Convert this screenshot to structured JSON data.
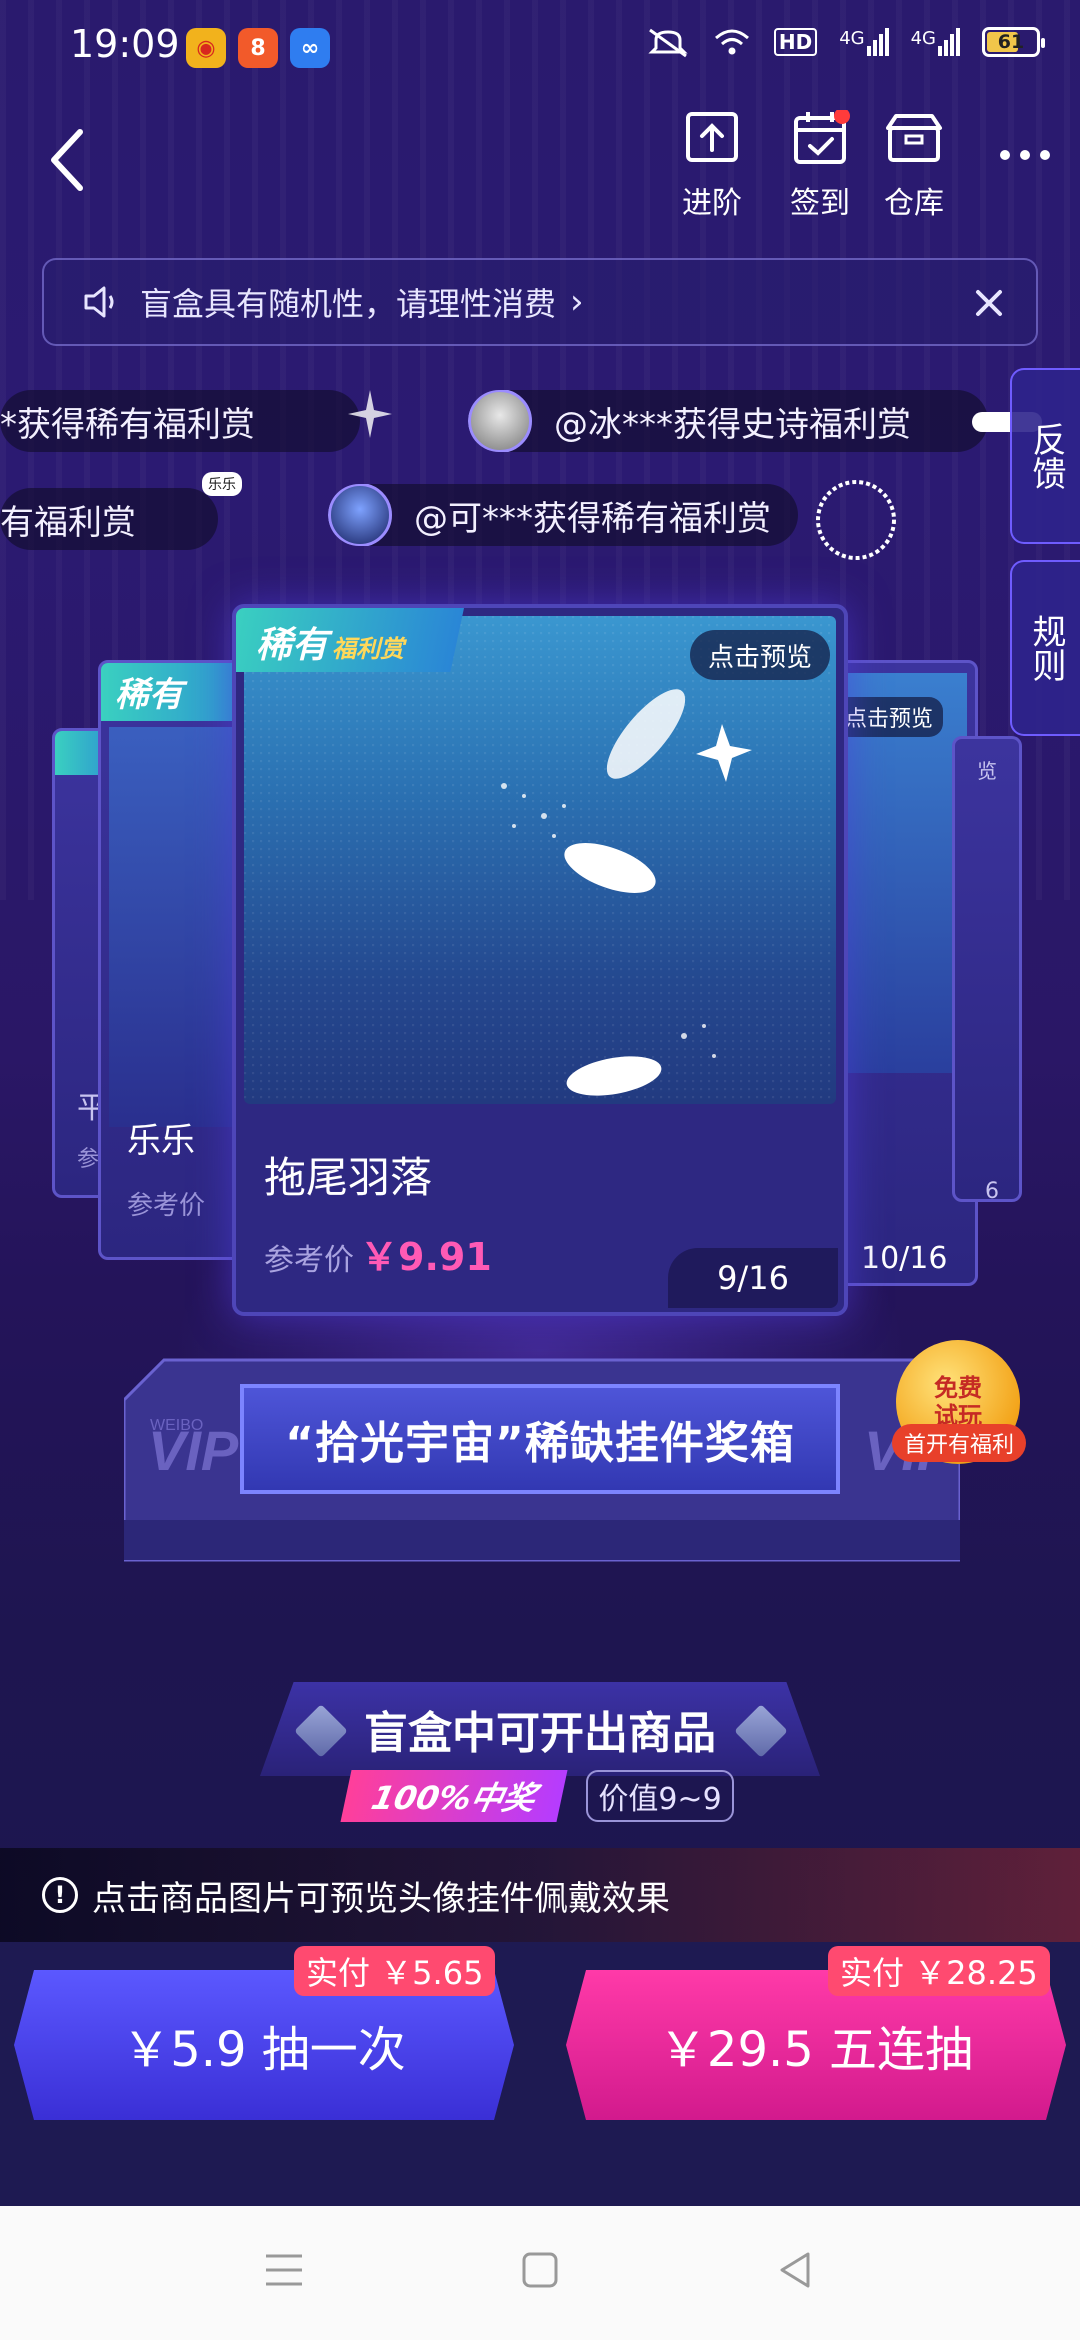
{
  "status_bar": {
    "time": "19:09",
    "battery": "61",
    "network": [
      "HD",
      "4G",
      "4G"
    ]
  },
  "top_nav": {
    "advance_label": "进阶",
    "checkin_label": "签到",
    "warehouse_label": "仓库"
  },
  "notice": {
    "text": "盲盒具有随机性，请理性消费"
  },
  "ticker": [
    "*获得稀有福利赏",
    "@冰***获得史诗福利赏",
    "有福利赏",
    "@可***获得稀有福利赏"
  ],
  "side_tabs": {
    "feedback": "反馈",
    "rules": "规则"
  },
  "main_card": {
    "tag": "稀有",
    "tag_sub": "福利赏",
    "preview": "点击预览",
    "name": "拖尾羽落",
    "ref_label": "参考价",
    "price": "￥9.91",
    "page": "9/16"
  },
  "left_card": {
    "tag": "稀有",
    "name": "乐乐",
    "ref_label": "参考价"
  },
  "far_left_card": {
    "name": "平",
    "ref_label": "参"
  },
  "right_card": {
    "preview": "点击预览",
    "page": "10/16"
  },
  "far_right_card": {
    "preview": "览",
    "page": "6"
  },
  "ticker_badge": "乐乐",
  "stage": {
    "title": "“拾光宇宙”稀缺挂件奖箱",
    "vip_label": "VIP",
    "brand": "WEIBO"
  },
  "free_badge": {
    "line1": "免费",
    "line2": "试玩",
    "ribbon": "首开有福利"
  },
  "section": {
    "title": "盲盒中可开出商品",
    "badge": "100%中奖",
    "value": "价值9~9"
  },
  "tip": {
    "text": "点击商品图片可预览头像挂件佩戴效果"
  },
  "buy": {
    "single_label": "￥5.9 抽一次",
    "single_pay": "实付 ￥5.65",
    "five_label": "￥29.5 五连抽",
    "five_pay": "实付 ￥28.25"
  },
  "colors": {
    "accent_pink": "#ff5ab5",
    "accent_blue": "#5b58ff",
    "badge_red": "#ff4a70"
  }
}
